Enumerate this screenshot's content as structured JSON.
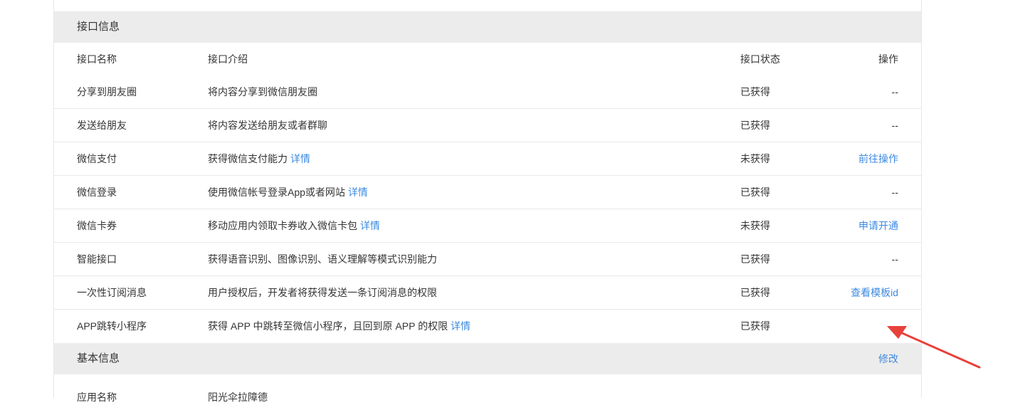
{
  "interface_section": {
    "title": "接口信息",
    "columns": {
      "name": "接口名称",
      "desc": "接口介绍",
      "status": "接口状态",
      "op": "操作"
    },
    "rows": [
      {
        "name": "分享到朋友圈",
        "desc": "将内容分享到微信朋友圈",
        "detail": "",
        "status": "已获得",
        "op": "--",
        "op_link": false
      },
      {
        "name": "发送给朋友",
        "desc": "将内容发送给朋友或者群聊",
        "detail": "",
        "status": "已获得",
        "op": "--",
        "op_link": false
      },
      {
        "name": "微信支付",
        "desc": "获得微信支付能力",
        "detail": "详情",
        "status": "未获得",
        "op": "前往操作",
        "op_link": true
      },
      {
        "name": "微信登录",
        "desc": "使用微信帐号登录App或者网站",
        "detail": "详情",
        "status": "已获得",
        "op": "--",
        "op_link": false
      },
      {
        "name": "微信卡券",
        "desc": "移动应用内领取卡券收入微信卡包",
        "detail": "详情",
        "status": "未获得",
        "op": "申请开通",
        "op_link": true
      },
      {
        "name": "智能接口",
        "desc": "获得语音识别、图像识别、语义理解等模式识别能力",
        "detail": "",
        "status": "已获得",
        "op": "--",
        "op_link": false
      },
      {
        "name": "一次性订阅消息",
        "desc": "用户授权后，开发者将获得发送一条订阅消息的权限",
        "detail": "",
        "status": "已获得",
        "op": "查看模板id",
        "op_link": true
      },
      {
        "name": "APP跳转小程序",
        "desc": "获得 APP 中跳转至微信小程序，且回到原 APP 的权限",
        "detail": "详情",
        "status": "已获得",
        "op": "--",
        "op_link": false
      }
    ]
  },
  "basic_section": {
    "title": "基本信息",
    "edit_label": "修改",
    "app_name_label": "应用名称",
    "app_name_value": "阳光伞拉障德"
  },
  "colors": {
    "link": "#3d8ae0",
    "section_bg": "#ececec",
    "annotation_arrow": "#e8413b"
  }
}
